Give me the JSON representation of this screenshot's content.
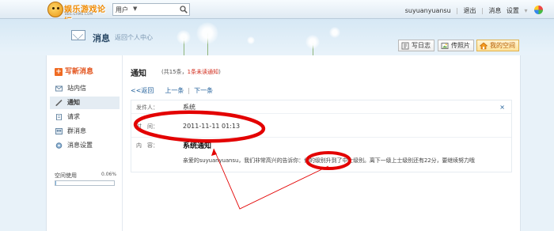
{
  "topbar": {
    "logo_text": "娱乐游戏论坛",
    "logo_sub": "BBS.GAME.COM",
    "search_scope": "用户",
    "search_value": "",
    "username": "suyuanyuansu",
    "links": [
      "退出",
      "消息",
      "设置"
    ]
  },
  "banner": {
    "title": "消息",
    "crumb": "返回个人中心",
    "buttons": [
      "写日志",
      "传照片",
      "我的空间"
    ]
  },
  "sidebar": {
    "compose": "写新消息",
    "items": [
      "站内信",
      "通知",
      "请求",
      "群消息",
      "消息设置"
    ],
    "active_index": 1,
    "space_label": "空间使用",
    "space_pct": "0.06%",
    "space_fraction": 0.0006
  },
  "content": {
    "title": "通知",
    "count_prefix": "(共15条，",
    "count_unread": "1条未读通知",
    "count_suffix": ")",
    "nav": {
      "back": "<<返回",
      "prev": "上一条",
      "next": "下一条"
    },
    "sender_label": "发件人：",
    "sender_value": "系统",
    "time_label": "时　间：",
    "time_value": "2011-11-11 01:13",
    "body_label": "内　容：",
    "close": "×",
    "notice_title": "系统通知",
    "notice_body": "亲爱的suyuanyuansu，我们非常高兴的告诉你：你的级别升到了中士级别。离下一级上士级别还有22分，要继续努力哦"
  },
  "colors": {
    "accent": "#1f5e99",
    "highlight_orange": "#e2521b",
    "annotation_red": "#e30000",
    "unread_red": "#d12a1a"
  }
}
